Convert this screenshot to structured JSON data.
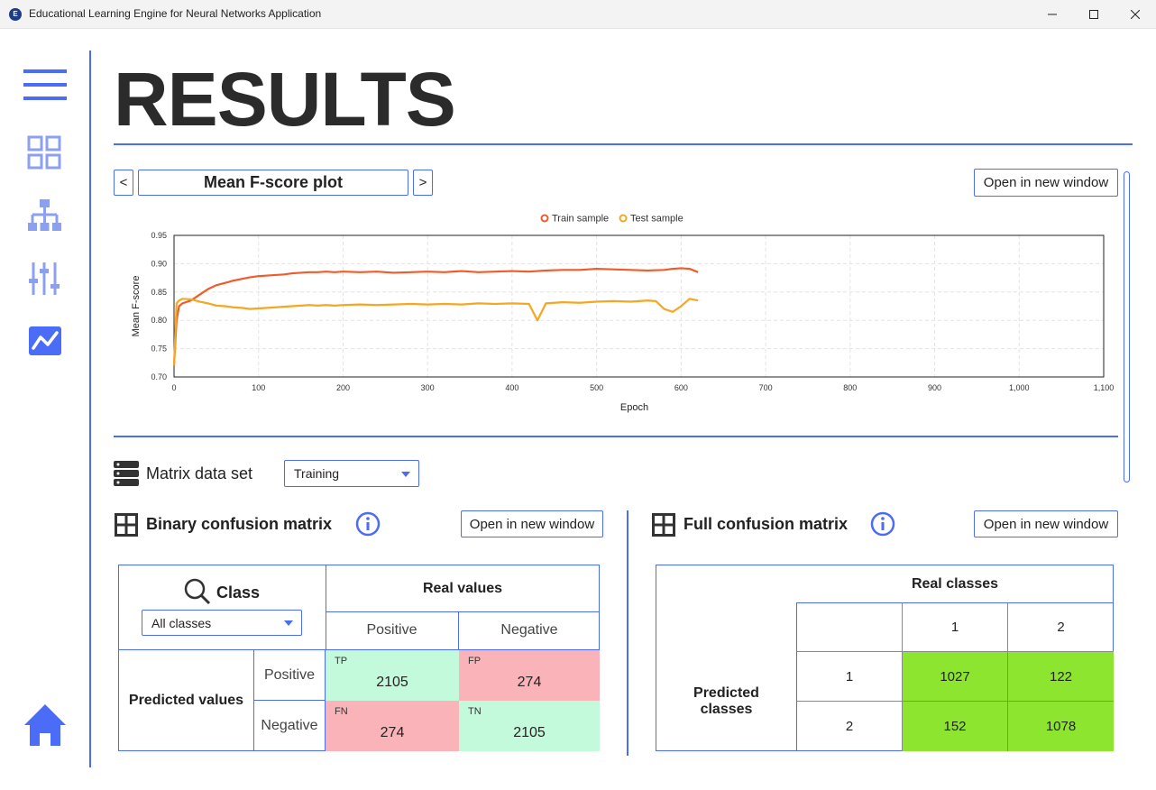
{
  "window": {
    "title": "Educational Learning Engine for Neural Networks Application",
    "icon_text": "E"
  },
  "sidebar": {
    "items": [
      {
        "icon": "hamburger-menu-icon"
      },
      {
        "icon": "grid-icon"
      },
      {
        "icon": "network-hierarchy-icon"
      },
      {
        "icon": "sliders-icon"
      },
      {
        "icon": "chart-line-icon",
        "active": true
      },
      {
        "icon": "home-icon"
      }
    ],
    "accent": "#4a6cf7"
  },
  "page": {
    "title": "RESULTS"
  },
  "plot_panel": {
    "prev_label": "<",
    "next_label": ">",
    "plot_name": "Mean F-score plot",
    "open_window_label": "Open in new window"
  },
  "chart_data": {
    "type": "line",
    "xlabel": "Epoch",
    "ylabel": "Mean F-score",
    "xlim": [
      0,
      1100
    ],
    "ylim": [
      0.7,
      0.95
    ],
    "x_ticks": [
      "0",
      "100",
      "200",
      "300",
      "400",
      "500",
      "600",
      "700",
      "800",
      "900",
      "1,000",
      "1,100"
    ],
    "y_ticks": [
      "0.70",
      "0.75",
      "0.80",
      "0.85",
      "0.90",
      "0.95"
    ],
    "grid": true,
    "legend_position": "top-center",
    "series": [
      {
        "name": "Train sample",
        "color": "#ef5b2a",
        "x": [
          0,
          3,
          6,
          10,
          20,
          30,
          40,
          50,
          60,
          70,
          80,
          90,
          100,
          110,
          120,
          130,
          140,
          150,
          160,
          170,
          180,
          190,
          200,
          220,
          240,
          260,
          280,
          300,
          320,
          340,
          360,
          380,
          400,
          420,
          440,
          460,
          480,
          500,
          520,
          540,
          560,
          580,
          590,
          600,
          610,
          620
        ],
        "y": [
          0.72,
          0.8,
          0.825,
          0.83,
          0.835,
          0.845,
          0.855,
          0.862,
          0.866,
          0.87,
          0.873,
          0.876,
          0.878,
          0.879,
          0.88,
          0.881,
          0.883,
          0.884,
          0.885,
          0.885,
          0.886,
          0.885,
          0.886,
          0.885,
          0.886,
          0.884,
          0.885,
          0.886,
          0.885,
          0.887,
          0.885,
          0.886,
          0.887,
          0.886,
          0.888,
          0.889,
          0.889,
          0.891,
          0.89,
          0.889,
          0.888,
          0.889,
          0.891,
          0.892,
          0.891,
          0.885
        ]
      },
      {
        "name": "Test sample",
        "color": "#f5a623",
        "x": [
          0,
          3,
          6,
          10,
          20,
          30,
          40,
          50,
          60,
          70,
          80,
          90,
          100,
          110,
          120,
          130,
          140,
          150,
          160,
          170,
          180,
          190,
          200,
          220,
          240,
          260,
          280,
          300,
          320,
          340,
          360,
          380,
          400,
          420,
          430,
          440,
          460,
          480,
          500,
          520,
          540,
          560,
          570,
          580,
          590,
          600,
          610,
          620
        ],
        "y": [
          0.72,
          0.83,
          0.835,
          0.838,
          0.837,
          0.833,
          0.83,
          0.826,
          0.825,
          0.823,
          0.822,
          0.82,
          0.821,
          0.822,
          0.823,
          0.824,
          0.825,
          0.826,
          0.827,
          0.826,
          0.827,
          0.826,
          0.827,
          0.828,
          0.827,
          0.828,
          0.829,
          0.828,
          0.829,
          0.828,
          0.83,
          0.829,
          0.83,
          0.829,
          0.8,
          0.83,
          0.832,
          0.831,
          0.833,
          0.834,
          0.833,
          0.835,
          0.834,
          0.82,
          0.815,
          0.825,
          0.838,
          0.835
        ]
      }
    ]
  },
  "matrix_set": {
    "label": "Matrix data set",
    "selected": "Training"
  },
  "binary_matrix": {
    "title": "Binary confusion matrix",
    "open_window_label": "Open in new window",
    "class_label": "Class",
    "class_selected": "All classes",
    "real_values_label": "Real values",
    "predicted_values_label": "Predicted values",
    "positive_label": "Positive",
    "negative_label": "Negative",
    "tp_tag": "TP",
    "tp_value": "2105",
    "fp_tag": "FP",
    "fp_value": "274",
    "fn_tag": "FN",
    "fn_value": "274",
    "tn_tag": "TN",
    "tn_value": "2105",
    "colors": {
      "correct": "#c2fadb",
      "wrong": "#fab4b9"
    }
  },
  "full_matrix": {
    "title": "Full confusion matrix",
    "open_window_label": "Open in new window",
    "real_classes_label": "Real classes",
    "predicted_classes_label": "Predicted classes",
    "col_headers": [
      "1",
      "2"
    ],
    "row_headers": [
      "1",
      "2"
    ],
    "values": [
      [
        "1027",
        "122"
      ],
      [
        "152",
        "1078"
      ]
    ],
    "cell_color": "#8ee52f"
  }
}
